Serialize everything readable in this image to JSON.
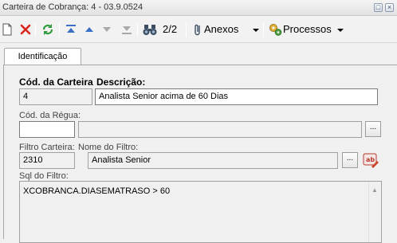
{
  "window": {
    "title": "Carteira de Cobrança: 4 - 03.9.0524"
  },
  "toolbar": {
    "record_position": "2/2",
    "attachments_label": "Anexos",
    "processes_label": "Processos"
  },
  "tabs": [
    {
      "label": "Identificação",
      "active": true
    }
  ],
  "form": {
    "carteira_label": "Cód. da Carteira",
    "descricao_label": "Descrição:",
    "carteira_value": "4",
    "descricao_value": "Analista Senior acima de 60 Dias",
    "regua_label": "Cód. da Régua:",
    "regua_code_value": "",
    "regua_desc_value": "",
    "filtro_label": "Filtro Carteira:",
    "filtro_value": "2310",
    "nome_filtro_label": "Nome do Filtro:",
    "nome_filtro_value": "Analista Senior",
    "sql_label": "Sql do Filtro:",
    "sql_value": "XCOBRANCA.DIASEMATRASO > 60",
    "ellipsis": "..."
  },
  "colors": {
    "toolbar_bg": "#f2f2f2",
    "field_border": "#7a7a7a",
    "readonly_bg": "#f0f0f0",
    "delete_red": "#d9261c",
    "refresh_green": "#2f9a3a",
    "nav_blue": "#3a6fc4"
  }
}
